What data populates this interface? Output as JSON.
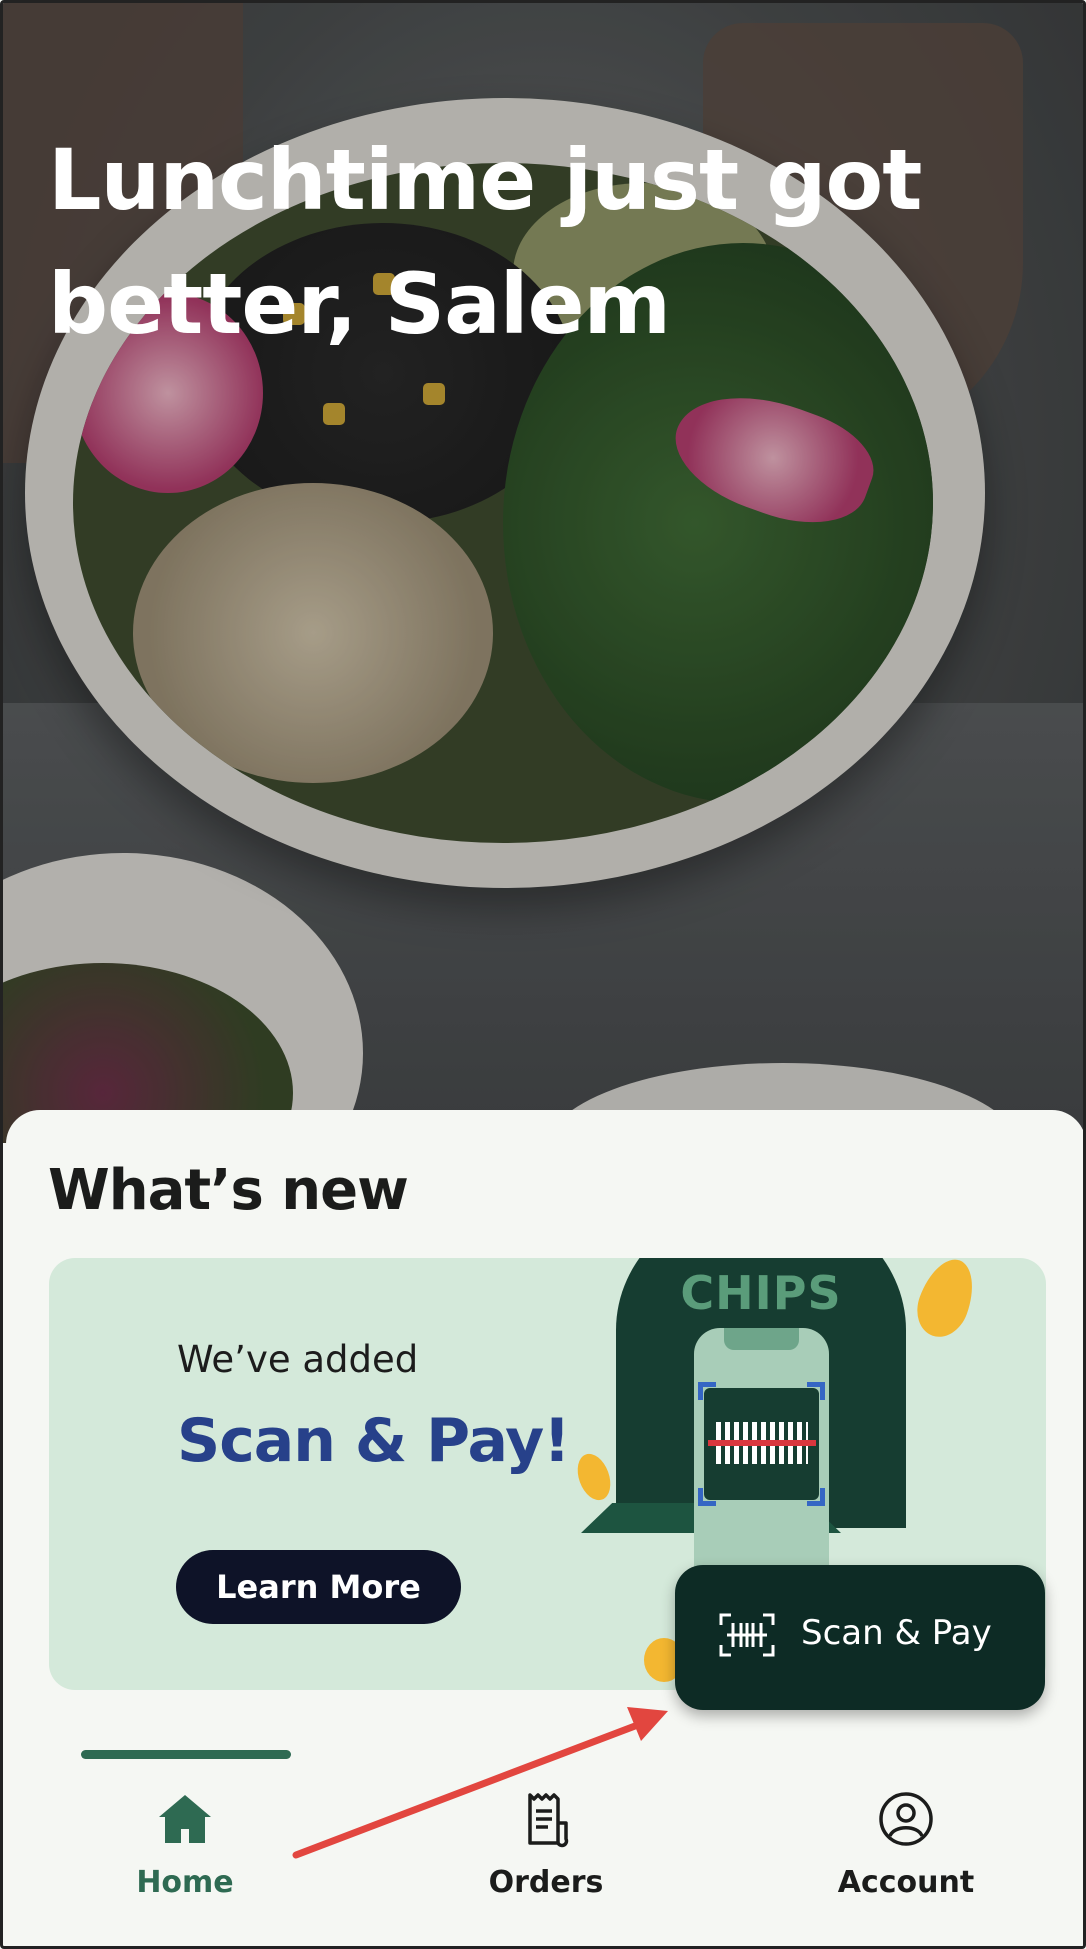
{
  "hero": {
    "title": "Lunchtime just got better, Salem"
  },
  "whats_new": {
    "title": "What’s new",
    "promo": {
      "subtitle": "We’ve added",
      "headline": "Scan & Pay!",
      "button_label": "Learn More",
      "illustration_label": "CHIPS"
    }
  },
  "scan_fab": {
    "label": "Scan & Pay",
    "icon": "barcode-scan-icon"
  },
  "nav": {
    "items": [
      {
        "label": "Home",
        "icon": "home-icon",
        "active": true
      },
      {
        "label": "Orders",
        "icon": "receipt-icon",
        "active": false
      },
      {
        "label": "Account",
        "icon": "account-icon",
        "active": false
      }
    ]
  },
  "colors": {
    "accent": "#2e6a52",
    "promo_bg": "#d4e9da",
    "headline": "#27418a",
    "fab_bg": "#0d2b25",
    "annotation_arrow": "#e2463f"
  }
}
